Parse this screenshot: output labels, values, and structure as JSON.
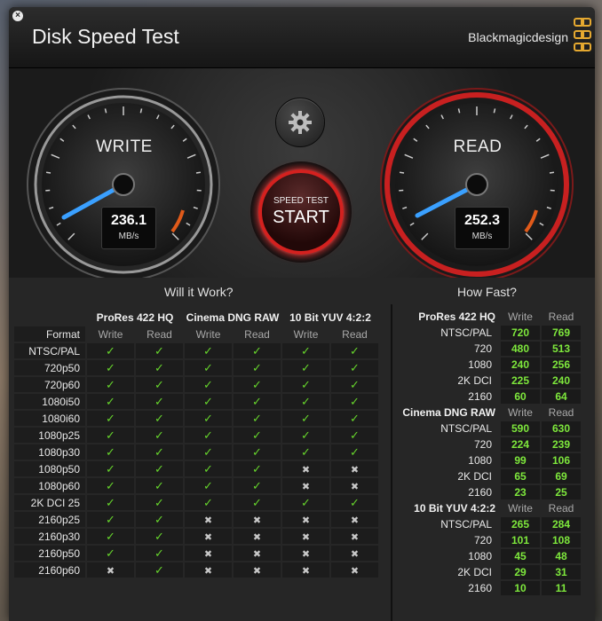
{
  "window": {
    "title": "Disk Speed Test",
    "brand": "Blackmagicdesign"
  },
  "gauges": {
    "write": {
      "label": "WRITE",
      "value": "236.1",
      "unit": "MB/s"
    },
    "read": {
      "label": "READ",
      "value": "252.3",
      "unit": "MB/s"
    }
  },
  "start_button": {
    "small": "SPEED TEST",
    "big": "START"
  },
  "will_it_work": {
    "title": "Will it Work?",
    "format_header": "Format",
    "codecs": [
      "ProRes 422 HQ",
      "Cinema DNG RAW",
      "10 Bit YUV 4:2:2"
    ],
    "sub_headers": [
      "Write",
      "Read"
    ],
    "rows": [
      {
        "format": "NTSC/PAL",
        "results": [
          1,
          1,
          1,
          1,
          1,
          1
        ]
      },
      {
        "format": "720p50",
        "results": [
          1,
          1,
          1,
          1,
          1,
          1
        ]
      },
      {
        "format": "720p60",
        "results": [
          1,
          1,
          1,
          1,
          1,
          1
        ]
      },
      {
        "format": "1080i50",
        "results": [
          1,
          1,
          1,
          1,
          1,
          1
        ]
      },
      {
        "format": "1080i60",
        "results": [
          1,
          1,
          1,
          1,
          1,
          1
        ]
      },
      {
        "format": "1080p25",
        "results": [
          1,
          1,
          1,
          1,
          1,
          1
        ]
      },
      {
        "format": "1080p30",
        "results": [
          1,
          1,
          1,
          1,
          1,
          1
        ]
      },
      {
        "format": "1080p50",
        "results": [
          1,
          1,
          1,
          1,
          0,
          0
        ]
      },
      {
        "format": "1080p60",
        "results": [
          1,
          1,
          1,
          1,
          0,
          0
        ]
      },
      {
        "format": "2K DCI 25",
        "results": [
          1,
          1,
          1,
          1,
          1,
          1
        ]
      },
      {
        "format": "2160p25",
        "results": [
          1,
          1,
          0,
          0,
          0,
          0
        ]
      },
      {
        "format": "2160p30",
        "results": [
          1,
          1,
          0,
          0,
          0,
          0
        ]
      },
      {
        "format": "2160p50",
        "results": [
          1,
          1,
          0,
          0,
          0,
          0
        ]
      },
      {
        "format": "2160p60",
        "results": [
          0,
          1,
          0,
          0,
          0,
          0
        ]
      }
    ]
  },
  "how_fast": {
    "title": "How Fast?",
    "sub_headers": [
      "Write",
      "Read"
    ],
    "groups": [
      {
        "codec": "ProRes 422 HQ",
        "rows": [
          {
            "format": "NTSC/PAL",
            "write": "720",
            "read": "769"
          },
          {
            "format": "720",
            "write": "480",
            "read": "513"
          },
          {
            "format": "1080",
            "write": "240",
            "read": "256"
          },
          {
            "format": "2K DCI",
            "write": "225",
            "read": "240"
          },
          {
            "format": "2160",
            "write": "60",
            "read": "64"
          }
        ]
      },
      {
        "codec": "Cinema DNG RAW",
        "rows": [
          {
            "format": "NTSC/PAL",
            "write": "590",
            "read": "630"
          },
          {
            "format": "720",
            "write": "224",
            "read": "239"
          },
          {
            "format": "1080",
            "write": "99",
            "read": "106"
          },
          {
            "format": "2K DCI",
            "write": "65",
            "read": "69"
          },
          {
            "format": "2160",
            "write": "23",
            "read": "25"
          }
        ]
      },
      {
        "codec": "10 Bit YUV 4:2:2",
        "rows": [
          {
            "format": "NTSC/PAL",
            "write": "265",
            "read": "284"
          },
          {
            "format": "720",
            "write": "101",
            "read": "108"
          },
          {
            "format": "1080",
            "write": "45",
            "read": "48"
          },
          {
            "format": "2K DCI",
            "write": "29",
            "read": "31"
          },
          {
            "format": "2160",
            "write": "10",
            "read": "11"
          }
        ]
      }
    ]
  },
  "icons": {
    "close": "close-icon",
    "settings": "gear-icon",
    "ok": "checkmark-icon",
    "no": "cross-icon"
  },
  "colors": {
    "ok": "#66d42c",
    "value": "#7ee83c",
    "start_ring": "#d4211f",
    "write_needle": "#3aa0ff",
    "brand": "#e6a930"
  }
}
